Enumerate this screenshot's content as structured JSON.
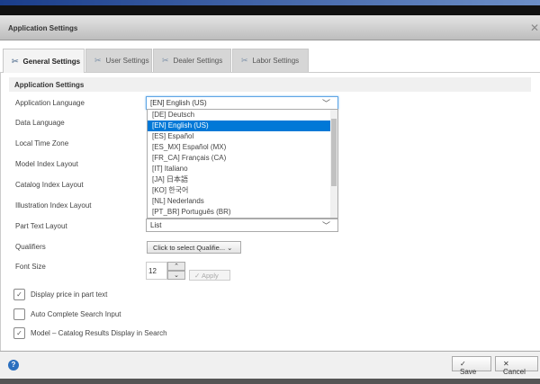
{
  "dialog": {
    "title": "Application Settings"
  },
  "tabs": [
    {
      "label": "General Settings"
    },
    {
      "label": "User Settings"
    },
    {
      "label": "Dealer Settings"
    },
    {
      "label": "Labor Settings"
    }
  ],
  "section": {
    "title": "Application Settings"
  },
  "labels": {
    "app_language": "Application Language",
    "data_language": "Data Language",
    "time_zone": "Local Time Zone",
    "model_index": "Model Index Layout",
    "catalog_index": "Catalog Index Layout",
    "illustration_index": "Illustration Index Layout",
    "part_text": "Part Text Layout",
    "qualifiers": "Qualifiers",
    "font_size": "Font Size"
  },
  "app_language": {
    "value": "[EN] English (US)",
    "options": [
      "[DE] Deutsch",
      "[EN] English (US)",
      "[ES] Español",
      "[ES_MX] Español (MX)",
      "[FR_CA] Français (CA)",
      "[IT] Italiano",
      "[JA] 日本語",
      "[KO] 한국어",
      "[NL] Nederlands",
      "[PT_BR] Português (BR)"
    ],
    "selected_index": 1
  },
  "part_text": {
    "value": "List"
  },
  "qualifiers": {
    "button": "Click to select Qualifie..."
  },
  "font_size": {
    "value": "12",
    "apply": "Apply"
  },
  "checkboxes": [
    {
      "label": "Display price in part text",
      "checked": true
    },
    {
      "label": "Auto Complete Search Input",
      "checked": false
    },
    {
      "label": "Model – Catalog Results Display in Search",
      "checked": true
    }
  ],
  "footer": {
    "save": "Save",
    "cancel": "Cancel"
  }
}
